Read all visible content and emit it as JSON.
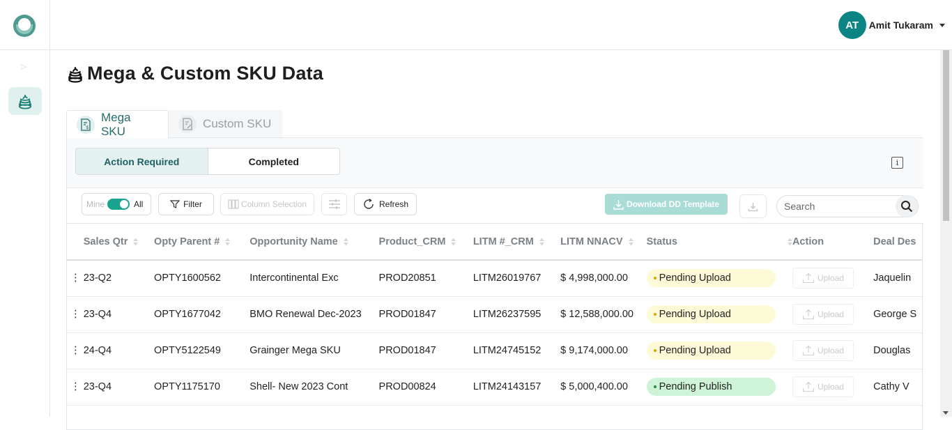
{
  "header": {
    "user": {
      "initials": "AT",
      "name": "Amit Tukaram"
    }
  },
  "page": {
    "title": "Mega & Custom SKU Data"
  },
  "tabs": [
    {
      "label": "Mega SKU",
      "active": true
    },
    {
      "label": "Custom SKU",
      "active": false
    }
  ],
  "segments": [
    {
      "label": "Action Required",
      "active": true
    },
    {
      "label": "Completed",
      "active": false
    }
  ],
  "toolbar": {
    "toggle_left": "Mine",
    "toggle_right": "All",
    "filter": "Filter",
    "column_selection": "Column Selection",
    "refresh": "Refresh",
    "download_template": "Download DD Template",
    "search_placeholder": "Search"
  },
  "table": {
    "columns": [
      "Sales Qtr",
      "Opty Parent #",
      "Opportunity Name",
      "Product_CRM",
      "LITM #_CRM",
      "LITM NNACV",
      "Status",
      "Action",
      "Deal Des"
    ],
    "upload_label": "Upload",
    "rows": [
      {
        "sales_qtr": "23-Q2",
        "opty_parent": "OPTY1600562",
        "opportunity_name": "Intercontinental Exc",
        "product_crm": "PROD20851",
        "litm_crm": "LITM26019767",
        "litm_nnacv": "$ 4,998,000.00",
        "status": "Pending Upload",
        "deal_desk": "Jaquelin"
      },
      {
        "sales_qtr": "23-Q4",
        "opty_parent": "OPTY1677042",
        "opportunity_name": "BMO Renewal Dec-2023",
        "product_crm": "PROD01847",
        "litm_crm": "LITM26237595",
        "litm_nnacv": "$ 12,588,000.00",
        "status": "Pending Upload",
        "deal_desk": "George S"
      },
      {
        "sales_qtr": "24-Q4",
        "opty_parent": "OPTY5122549",
        "opportunity_name": "Grainger Mega SKU",
        "product_crm": "PROD01847",
        "litm_crm": "LITM24745152",
        "litm_nnacv": "$ 9,174,000.00",
        "status": "Pending Upload",
        "deal_desk": "Douglas"
      },
      {
        "sales_qtr": "23-Q4",
        "opty_parent": "OPTY1175170",
        "opportunity_name": "Shell- New 2023 Cont",
        "product_crm": "PROD00824",
        "litm_crm": "LITM24143157",
        "litm_nnacv": "$ 5,000,400.00",
        "status": "Pending Publish",
        "deal_desk": "Cathy V"
      }
    ]
  },
  "colors": {
    "accent": "#0d8484",
    "status_upload_bg": "#fdfbd7",
    "status_publish_bg": "#cff3d7",
    "download_template_bg": "#a8dcd5"
  },
  "icons": {
    "app_logo": "ring-logo-icon",
    "page_title": "coin-stack-icon",
    "mega_tab": "invoice-dollar-icon",
    "custom_tab": "document-edit-icon",
    "info": "info-icon",
    "filter": "filter-icon",
    "column_selection": "columns-icon",
    "adjust": "sliders-icon",
    "refresh": "refresh-icon",
    "download": "download-icon",
    "search": "search-icon",
    "upload": "upload-icon"
  }
}
